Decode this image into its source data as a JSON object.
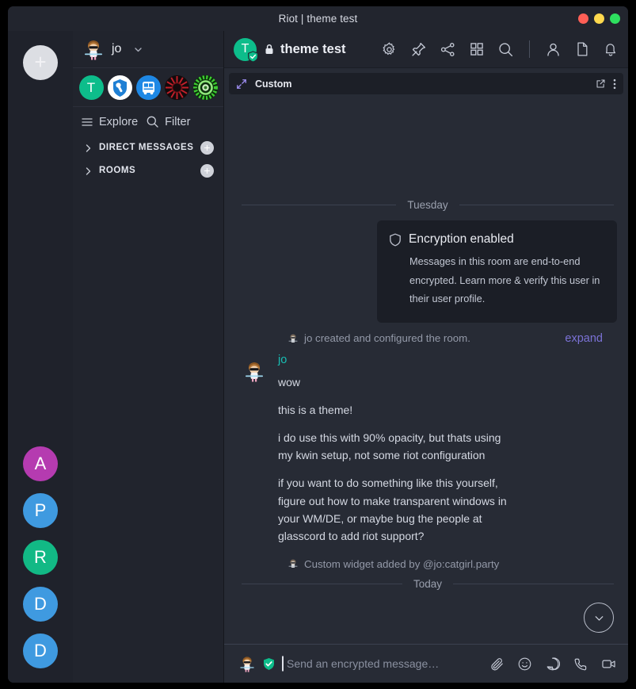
{
  "window": {
    "title": "Riot | theme test",
    "controls": [
      {
        "name": "close",
        "color": "#ff5f56"
      },
      {
        "name": "minimize",
        "color": "#ffd94e"
      },
      {
        "name": "maximize",
        "color": "#2ee05f"
      }
    ]
  },
  "rail": {
    "add_label": "+",
    "avatars": [
      {
        "letter": "A",
        "color": "#b53bb0"
      },
      {
        "letter": "P",
        "color": "#3f9ae0"
      },
      {
        "letter": "R",
        "color": "#12b985"
      },
      {
        "letter": "D",
        "color": "#3f9ae0"
      },
      {
        "letter": "D",
        "color": "#3f9ae0"
      }
    ]
  },
  "sidebar": {
    "user": {
      "name": "jo",
      "avatar": "pixel-character-avatar"
    },
    "groups": [
      {
        "name": "group-t",
        "label": "T",
        "icon": "letter-t"
      },
      {
        "name": "group-wrench",
        "label": "",
        "icon": "shield-wrench-icon"
      },
      {
        "name": "group-transit",
        "label": "",
        "icon": "tram-icon"
      },
      {
        "name": "group-burst",
        "label": "",
        "icon": "red-radial-burst-icon"
      },
      {
        "name": "group-gear",
        "label": "",
        "icon": "green-radial-gear-icon"
      }
    ],
    "explore_label": "Explore",
    "filter_label": "Filter",
    "sections": [
      {
        "title": "DIRECT MESSAGES",
        "add_label": "+"
      },
      {
        "title": "ROOMS",
        "add_label": "+"
      }
    ]
  },
  "room": {
    "avatar_letter": "T",
    "title": "theme test",
    "header_icons": [
      "gear-icon",
      "pin-icon",
      "share-icon",
      "apps-grid-icon",
      "search-icon",
      "people-icon",
      "files-icon",
      "notifications-bell-icon"
    ]
  },
  "widget": {
    "label": "Custom",
    "expand_icon": "expand-arrows-icon",
    "popout_icon": "popout-icon",
    "menu_icon": "overflow-menu-icon"
  },
  "timeline": {
    "date_separator_top": "Tuesday",
    "date_separator_bottom": "Today",
    "encryption": {
      "title": "Encryption enabled",
      "body": "Messages in this room are end-to-end encrypted. Learn more & verify this user in their user profile.",
      "icon": "shield-icon"
    },
    "events": [
      {
        "text": "jo created and configured the room.",
        "action_label": "expand"
      },
      {
        "text": "Custom widget added by @jo:catgirl.party"
      }
    ],
    "message": {
      "sender": "jo",
      "sender_color": "#17bfb4",
      "lines": [
        "wow",
        "this is a theme!",
        "i do use this with 90% opacity, but thats using my kwin setup, not some riot configuration",
        "if you want to do something like this yourself, figure out how to make transparent windows in your WM/DE, or maybe bug the people at glasscord to add riot support?"
      ]
    },
    "scroll_down_icon": "chevron-down-icon"
  },
  "composer": {
    "placeholder": "Send an encrypted message…",
    "value": "",
    "shield_icon": "encrypted-shield-icon",
    "icons": [
      "attachment-paperclip-icon",
      "emoji-smiley-icon",
      "sticker-icon",
      "voice-call-icon",
      "video-call-icon"
    ]
  },
  "colors": {
    "accent_green": "#0dbd8b",
    "accent_purple": "#7b72d6",
    "sender_teal": "#17bfb4",
    "background": "#272b35",
    "panel": "#21242d"
  }
}
